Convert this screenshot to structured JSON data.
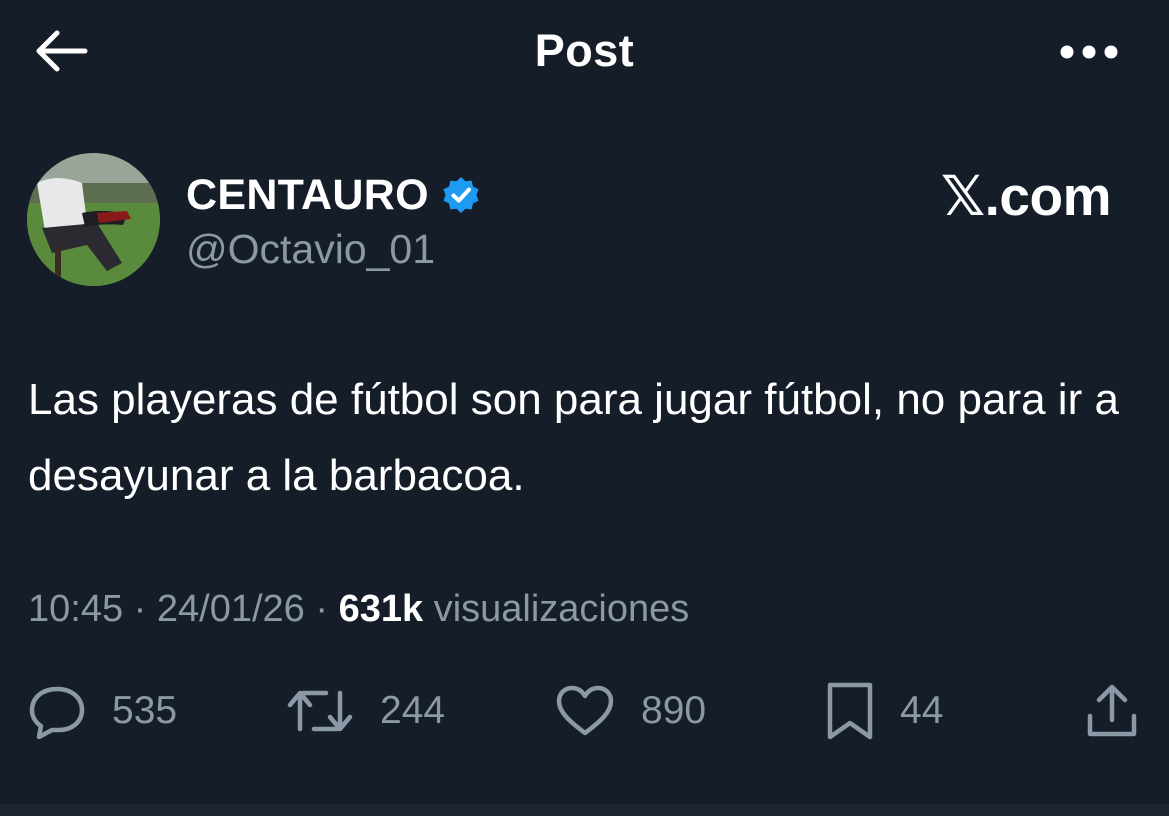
{
  "header": {
    "title": "Post",
    "back_icon": "arrow-left-icon",
    "more_icon": "more-horizontal-icon"
  },
  "author": {
    "display_name": "CENTAURO",
    "handle": "@Octavio_01",
    "verified": true,
    "verified_color": "#1d9bf0"
  },
  "source_label": "𝕏.com",
  "post": {
    "text": "Las playeras de fútbol son para jugar fútbol, no para ir a desayunar a la barbacoa."
  },
  "meta": {
    "time": "10:45",
    "date": "24/01/26",
    "views_count": "631k",
    "views_label": "visualizaciones",
    "separator": "·"
  },
  "actions": {
    "replies": "535",
    "reposts": "244",
    "likes": "890",
    "bookmarks": "44"
  },
  "colors": {
    "background": "#151d28",
    "text_primary": "#ffffff",
    "text_secondary": "#8b98a5"
  }
}
